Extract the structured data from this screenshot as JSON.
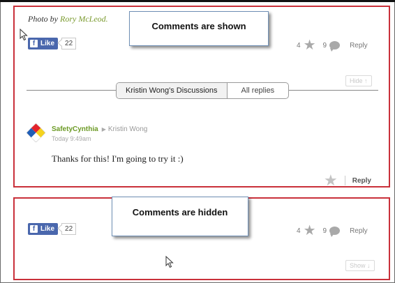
{
  "comments_shown": {
    "photo_credit_prefix": "Photo by",
    "photo_credit_author": "Rory McLeod.",
    "facebook": {
      "like_label": "Like",
      "like_icon": "f",
      "count": "22"
    },
    "callout": "Comments are shown",
    "stats": {
      "likes": "4",
      "comments": "9",
      "reply_label": "Reply"
    },
    "tabs": [
      {
        "label": "Kristin Wong's Discussions",
        "active": true
      },
      {
        "label": "All replies",
        "active": false
      }
    ],
    "hide_label": "Hide ↑",
    "comment": {
      "username": "SafetyCynthia",
      "reply_to": "Kristin Wong",
      "timestamp": "Today 9:49am",
      "text": "Thanks for this! I'm going to try it :)",
      "reply_label": "Reply"
    }
  },
  "comments_hidden": {
    "facebook": {
      "like_label": "Like",
      "like_icon": "f",
      "count": "22"
    },
    "callout": "Comments are hidden",
    "stats": {
      "likes": "4",
      "comments": "9",
      "reply_label": "Reply"
    },
    "show_label": "Show ↓"
  },
  "colors": {
    "highlight_border": "#c9303a",
    "facebook_blue": "#4a67ad",
    "username_green": "#6c9a25",
    "author_green": "#7a9a2e"
  },
  "icons": [
    "arrow-cursor-icon",
    "facebook-f-icon",
    "star-icon",
    "comment-bubble-icon",
    "triangle-right-icon",
    "diamond-avatar-icon"
  ]
}
